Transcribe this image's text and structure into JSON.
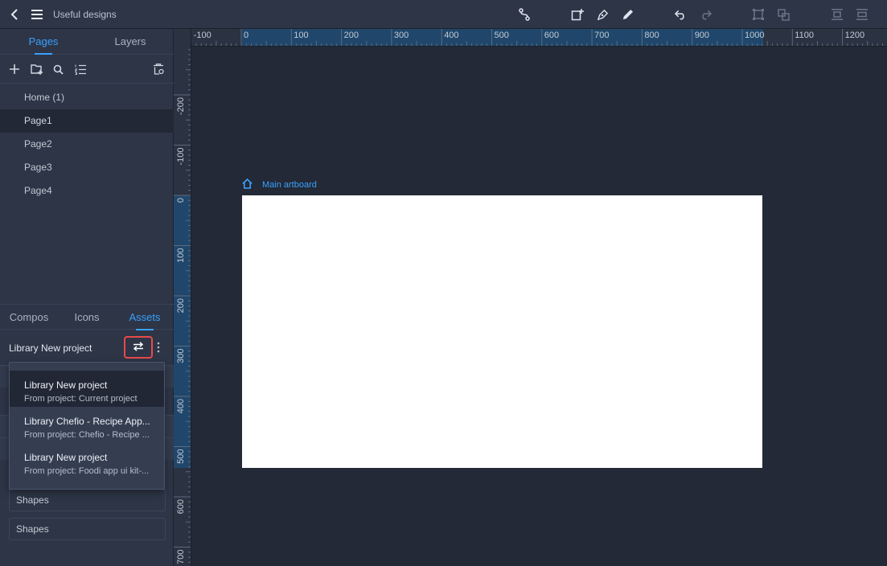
{
  "header": {
    "title": "Useful designs",
    "icons": [
      "back-icon",
      "menu-icon",
      "connector-icon",
      "add-artboard-icon",
      "pen-icon",
      "pencil-icon",
      "undo-icon",
      "redo-icon",
      "group-icon",
      "ungroup-icon",
      "distribute-vertical-icon",
      "distribute-horizontal-icon"
    ]
  },
  "left_tabs": [
    {
      "label": "Pages",
      "active": true
    },
    {
      "label": "Layers",
      "active": false
    }
  ],
  "page_tools": [
    "add-icon",
    "add-folder-icon",
    "search-icon",
    "sort-list-icon",
    "delete-icon"
  ],
  "pages": [
    {
      "label": "Home (1)",
      "selected": false
    },
    {
      "label": "Page1",
      "selected": true
    },
    {
      "label": "Page2",
      "selected": false
    },
    {
      "label": "Page3",
      "selected": false
    },
    {
      "label": "Page4",
      "selected": false
    }
  ],
  "asset_tabs": [
    {
      "label": "Compos",
      "active": false
    },
    {
      "label": "Icons",
      "active": false
    },
    {
      "label": "Assets",
      "active": true
    }
  ],
  "library": {
    "title": "Library New project",
    "dropdown": [
      {
        "name": "Library New project",
        "source": "From project: Current project",
        "selected": true
      },
      {
        "name": "Library Chefio - Recipe App...",
        "source": "From project: Chefio - Recipe ...",
        "selected": false
      },
      {
        "name": "Library New project",
        "source": "From project: Foodi app ui kit-...",
        "selected": false
      }
    ],
    "rows": [
      "Shapes",
      "Shapes"
    ]
  },
  "rulers": {
    "horizontal": [
      "-100",
      "0",
      "100",
      "200",
      "300",
      "400",
      "500",
      "600",
      "700",
      "800",
      "900",
      "1000",
      "1100",
      "1200"
    ],
    "vertical": [
      "-200",
      "-100",
      "0",
      "100",
      "200",
      "300",
      "400",
      "500",
      "600",
      "700"
    ]
  },
  "canvas": {
    "artboard_label": "Main artboard"
  },
  "colors": {
    "accent": "#3aa0ff",
    "highlight": "#e94a4a",
    "panel": "#2d3546",
    "canvas": "#232936"
  }
}
